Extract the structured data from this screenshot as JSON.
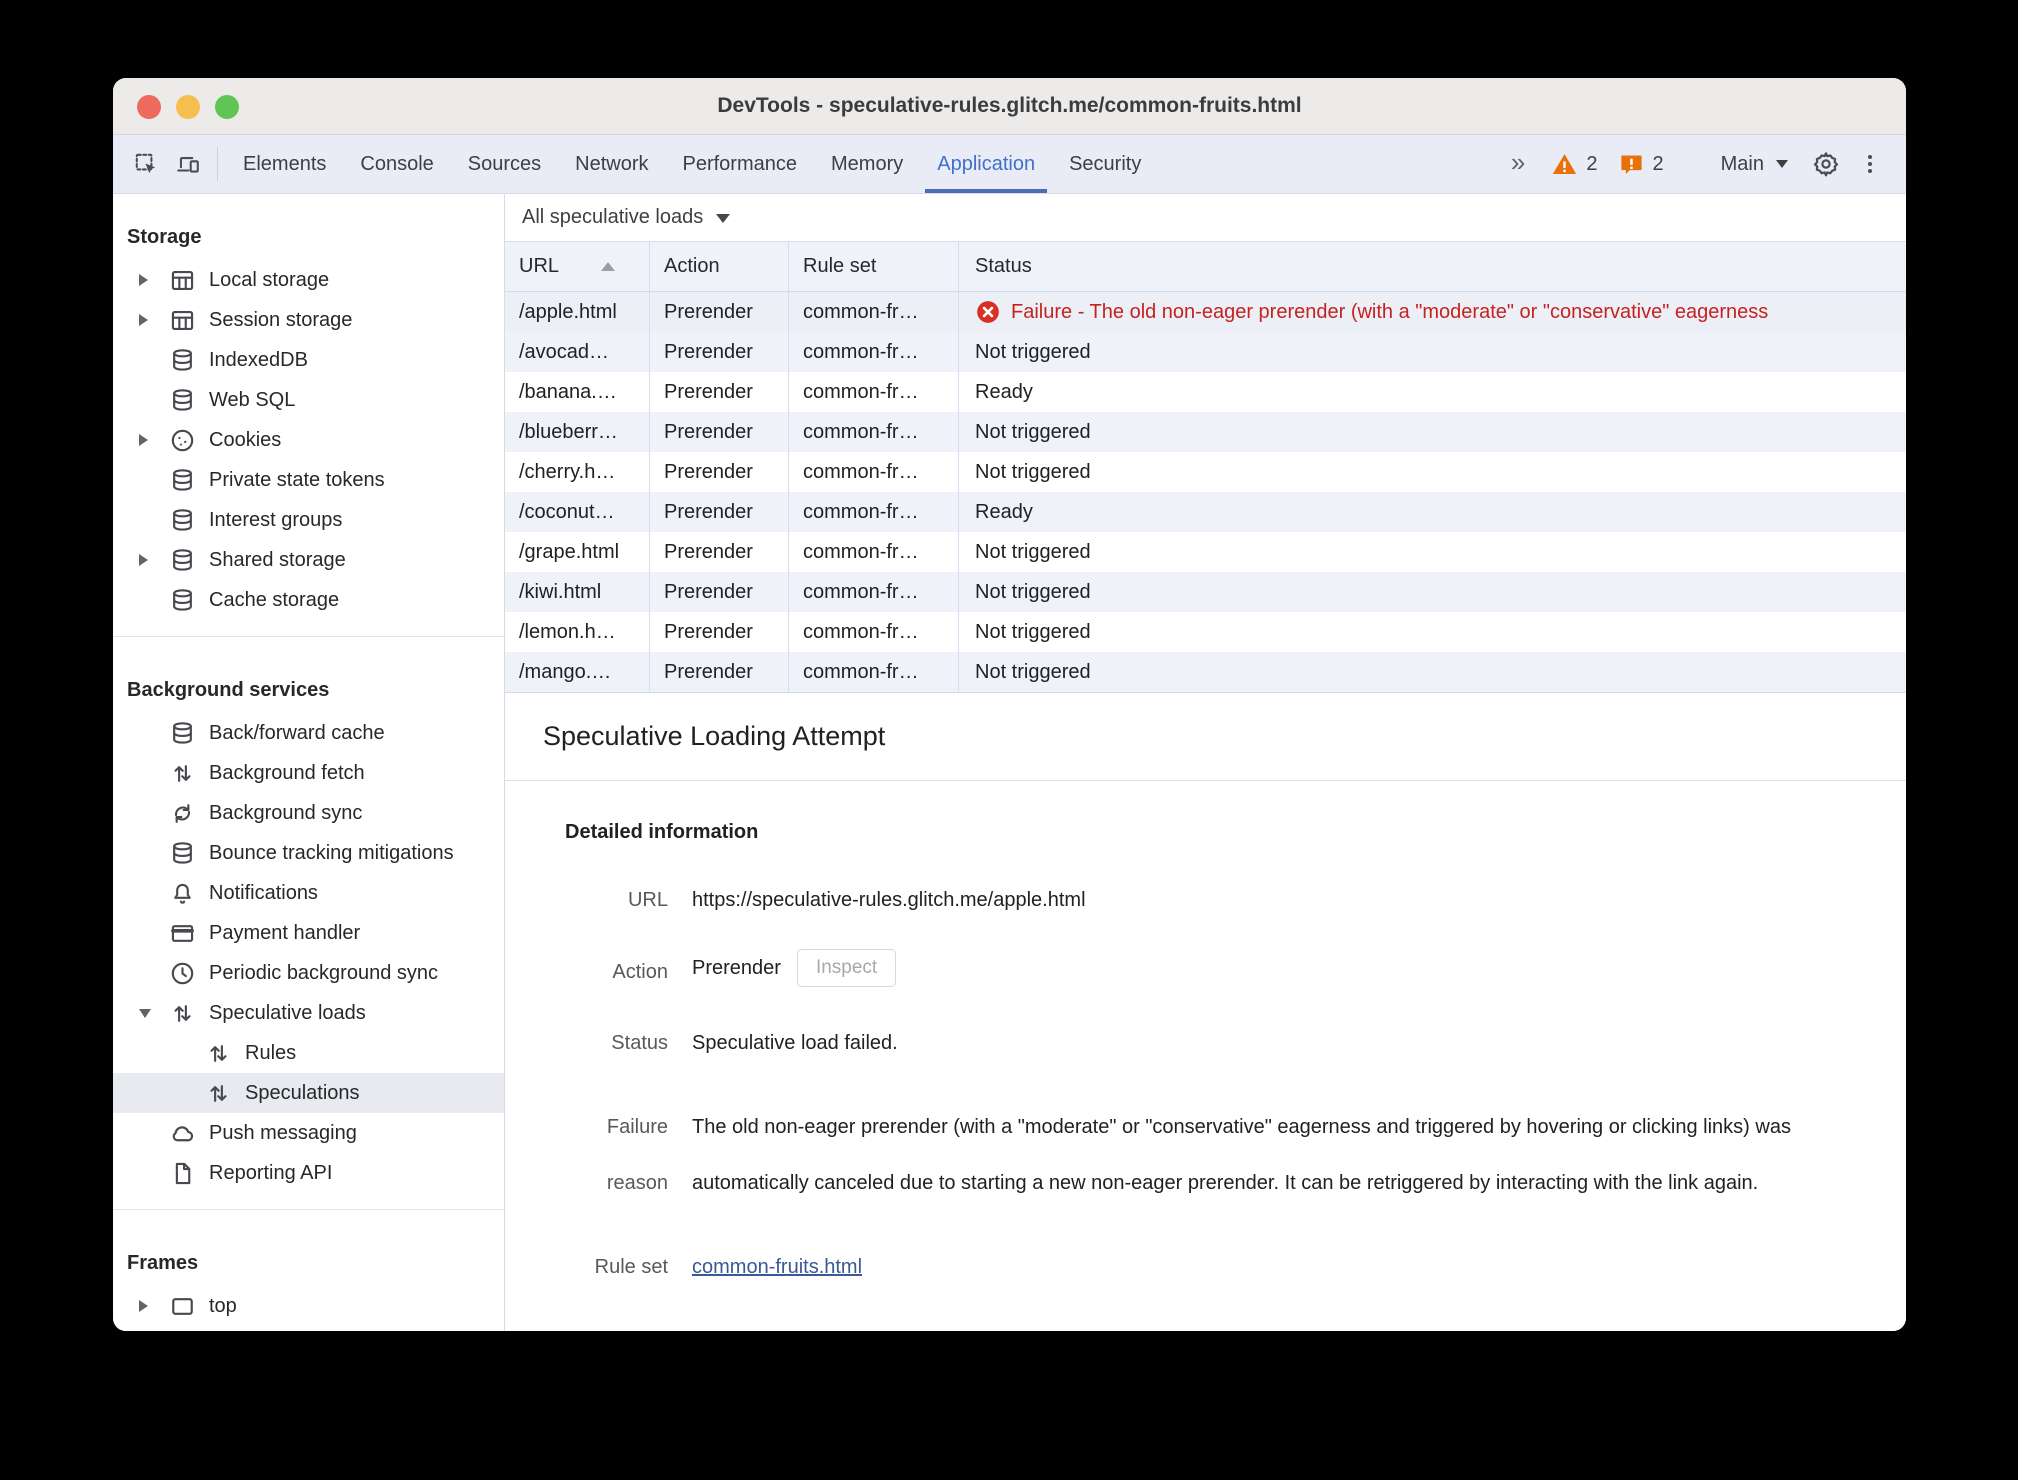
{
  "window": {
    "title": "DevTools - speculative-rules.glitch.me/common-fruits.html"
  },
  "colors": {
    "accent_blue": "#4070c8",
    "warning_orange": "#e8710a",
    "error_red": "#c5221f",
    "link_blue": "#3a5896",
    "stripe": "#f0f2fa"
  },
  "toolbar": {
    "tabs": [
      {
        "label": "Elements"
      },
      {
        "label": "Console"
      },
      {
        "label": "Sources"
      },
      {
        "label": "Network"
      },
      {
        "label": "Performance"
      },
      {
        "label": "Memory"
      },
      {
        "label": "Application",
        "active": true
      },
      {
        "label": "Security"
      }
    ],
    "overflow_label": "»",
    "warnings_count": "2",
    "issues_count": "2",
    "target_label": "Main"
  },
  "sidebar": {
    "sections": [
      {
        "title": "Storage",
        "items": [
          {
            "label": "Local storage",
            "icon": "table",
            "expand": "collapsed"
          },
          {
            "label": "Session storage",
            "icon": "table",
            "expand": "collapsed"
          },
          {
            "label": "IndexedDB",
            "icon": "database"
          },
          {
            "label": "Web SQL",
            "icon": "database"
          },
          {
            "label": "Cookies",
            "icon": "cookie",
            "expand": "collapsed"
          },
          {
            "label": "Private state tokens",
            "icon": "database"
          },
          {
            "label": "Interest groups",
            "icon": "database"
          },
          {
            "label": "Shared storage",
            "icon": "database",
            "expand": "collapsed"
          },
          {
            "label": "Cache storage",
            "icon": "database"
          }
        ]
      },
      {
        "title": "Background services",
        "items": [
          {
            "label": "Back/forward cache",
            "icon": "database"
          },
          {
            "label": "Background fetch",
            "icon": "updown"
          },
          {
            "label": "Background sync",
            "icon": "sync"
          },
          {
            "label": "Bounce tracking mitigations",
            "icon": "database"
          },
          {
            "label": "Notifications",
            "icon": "bell"
          },
          {
            "label": "Payment handler",
            "icon": "card"
          },
          {
            "label": "Periodic background sync",
            "icon": "clock"
          },
          {
            "label": "Speculative loads",
            "icon": "updown",
            "expand": "expanded",
            "children": [
              {
                "label": "Rules",
                "icon": "updown"
              },
              {
                "label": "Speculations",
                "icon": "updown",
                "selected": true
              }
            ]
          },
          {
            "label": "Push messaging",
            "icon": "cloud"
          },
          {
            "label": "Reporting API",
            "icon": "file"
          }
        ]
      },
      {
        "title": "Frames",
        "items": [
          {
            "label": "top",
            "icon": "frame",
            "expand": "collapsed"
          }
        ]
      }
    ]
  },
  "main": {
    "filter": {
      "label": "All speculative loads"
    },
    "table": {
      "columns": [
        "URL",
        "Action",
        "Rule set",
        "Status"
      ],
      "rows": [
        {
          "url": "/apple.html",
          "action": "Prerender",
          "rule_set": "common-fr…",
          "status": "Failure - The old non-eager prerender (with a \"moderate\" or \"conservative\" eagerness",
          "failed": true,
          "selected": true
        },
        {
          "url": "/avocad…",
          "action": "Prerender",
          "rule_set": "common-fr…",
          "status": "Not triggered"
        },
        {
          "url": "/banana.…",
          "action": "Prerender",
          "rule_set": "common-fr…",
          "status": "Ready"
        },
        {
          "url": "/blueberr…",
          "action": "Prerender",
          "rule_set": "common-fr…",
          "status": "Not triggered"
        },
        {
          "url": "/cherry.h…",
          "action": "Prerender",
          "rule_set": "common-fr…",
          "status": "Not triggered"
        },
        {
          "url": "/coconut…",
          "action": "Prerender",
          "rule_set": "common-fr…",
          "status": "Ready"
        },
        {
          "url": "/grape.html",
          "action": "Prerender",
          "rule_set": "common-fr…",
          "status": "Not triggered"
        },
        {
          "url": "/kiwi.html",
          "action": "Prerender",
          "rule_set": "common-fr…",
          "status": "Not triggered"
        },
        {
          "url": "/lemon.h…",
          "action": "Prerender",
          "rule_set": "common-fr…",
          "status": "Not triggered"
        },
        {
          "url": "/mango.…",
          "action": "Prerender",
          "rule_set": "common-fr…",
          "status": "Not triggered"
        }
      ]
    },
    "detail": {
      "title": "Speculative Loading Attempt",
      "section_heading": "Detailed information",
      "url_label": "URL",
      "url_value": "https://speculative-rules.glitch.me/apple.html",
      "action_label": "Action",
      "action_value": "Prerender",
      "inspect_label": "Inspect",
      "status_label": "Status",
      "status_value": "Speculative load failed.",
      "failure_label": "Failure reason",
      "failure_value": "The old non-eager prerender (with a \"moderate\" or \"conservative\" eagerness and triggered by hovering or clicking links) was automatically canceled due to starting a new non-eager prerender. It can be retriggered by interacting with the link again.",
      "ruleset_label": "Rule set",
      "ruleset_link": "common-fruits.html"
    }
  }
}
